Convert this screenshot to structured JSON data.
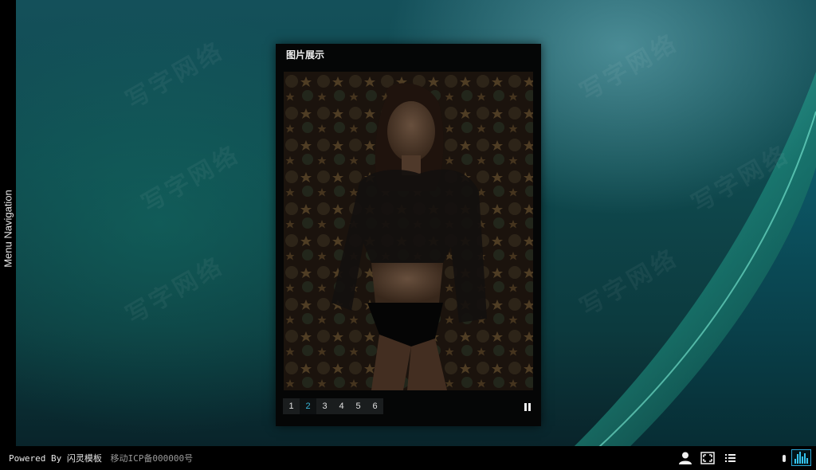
{
  "side_menu": {
    "label": "Menu Navigation"
  },
  "gallery": {
    "title": "图片展示",
    "pages": [
      "1",
      "2",
      "3",
      "4",
      "5",
      "6"
    ],
    "active_page": "2"
  },
  "footer": {
    "powered_by": "Powered By 闪灵模板",
    "icp": "移动ICP备000000号"
  },
  "icons": {
    "user": "user-icon",
    "fullscreen": "fullscreen-icon",
    "list": "list-icon",
    "volume": "volume-icon",
    "music": "music-equalizer-icon",
    "pause": "pause-icon"
  },
  "colors": {
    "accent": "#35c4ef",
    "active_page": "#39b6d8"
  }
}
